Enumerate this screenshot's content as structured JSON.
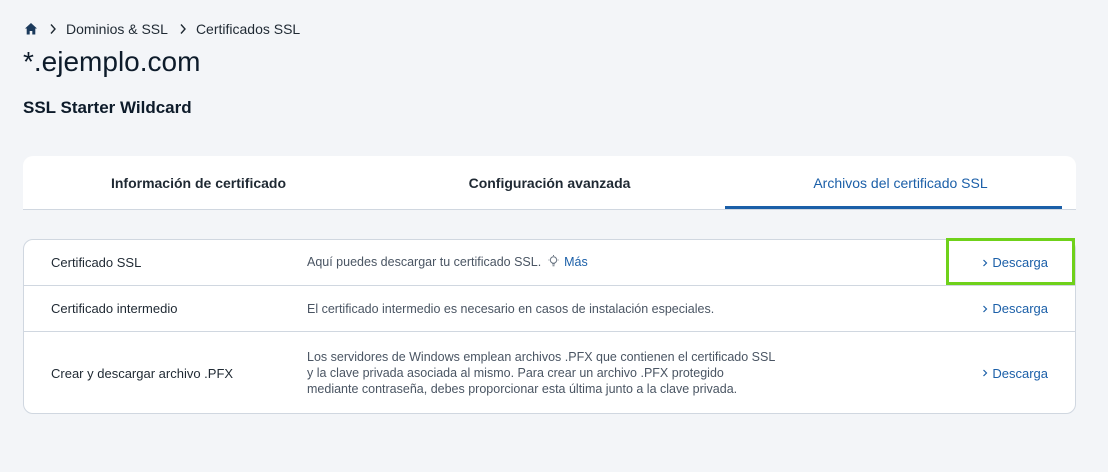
{
  "breadcrumb": {
    "home_icon": "home-icon",
    "items": [
      "Dominios & SSL",
      "Certificados SSL"
    ]
  },
  "page": {
    "title": "*.ejemplo.com",
    "subtitle": "SSL Starter Wildcard"
  },
  "tabs": [
    {
      "label": "Información de certificado",
      "active": false
    },
    {
      "label": "Configuración avanzada",
      "active": false
    },
    {
      "label": "Archivos del certificado SSL",
      "active": true
    }
  ],
  "files": [
    {
      "name": "Certificado SSL",
      "description": "Aquí puedes descargar tu certificado SSL.",
      "more_label": "Más",
      "action_label": "Descarga",
      "highlighted": true
    },
    {
      "name": "Certificado intermedio",
      "description": "El certificado intermedio es necesario en casos de instalación especiales.",
      "action_label": "Descarga"
    },
    {
      "name": "Crear y descargar archivo .PFX",
      "description_lines": [
        "Los servidores de Windows emplean archivos .PFX que contienen el certificado SSL",
        "y la clave privada asociada al mismo. Para crear un archivo .PFX protegido",
        "mediante contraseña, debes proporcionar esta última junto a la clave privada."
      ],
      "action_label": "Descarga"
    }
  ],
  "colors": {
    "accent": "#1b5fa8",
    "highlight": "#6fd11a",
    "background": "#f3f5f8"
  }
}
